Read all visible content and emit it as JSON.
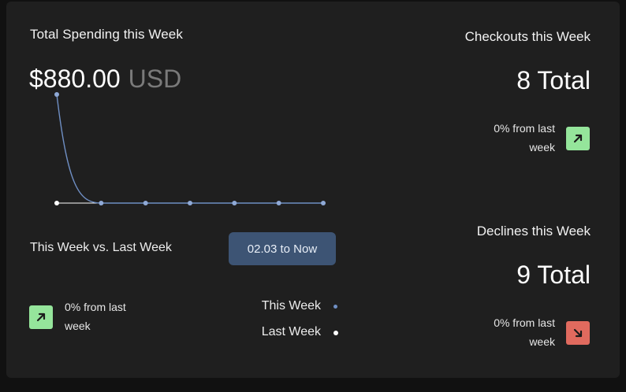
{
  "spending": {
    "title": "Total Spending this Week",
    "amount": "$880.00",
    "currency": "USD"
  },
  "comparison": {
    "label": "This Week vs. Last Week",
    "date_range_button": "02.03 to Now",
    "change_line1": "0% from last",
    "change_line2": "week",
    "legend": [
      {
        "label": "This Week",
        "color": "#6f8fc4"
      },
      {
        "label": "Last Week",
        "color": "#ffffff"
      }
    ]
  },
  "checkouts": {
    "title": "Checkouts this Week",
    "total": "8 Total",
    "change_line1": "0% from last",
    "change_line2": "week",
    "trend": "up"
  },
  "declines": {
    "title": "Declines this Week",
    "total": "9 Total",
    "change_line1": "0% from last",
    "change_line2": "week",
    "trend": "down"
  },
  "colors": {
    "background": "#111111",
    "card": "#1f1f1f",
    "accent_blue": "#3d5474",
    "up_green": "#95e59b",
    "down_red": "#e06a5e",
    "this_week_line": "#6f8fc4",
    "last_week_line": "#ffffff"
  },
  "chart_data": {
    "type": "line",
    "x": [
      1,
      2,
      3,
      4,
      5,
      6,
      7
    ],
    "series": [
      {
        "name": "This Week",
        "values": [
          880,
          0,
          0,
          0,
          0,
          0,
          0
        ]
      },
      {
        "name": "Last Week",
        "values": [
          0,
          0,
          0,
          0,
          0,
          0,
          0
        ]
      }
    ],
    "ylim": [
      0,
      880
    ],
    "grid": false
  }
}
